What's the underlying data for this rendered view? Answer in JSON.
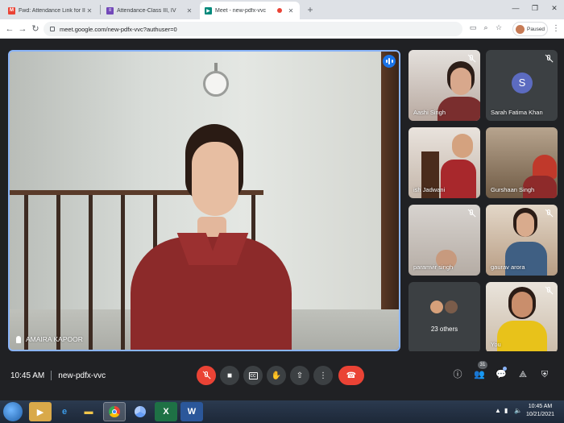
{
  "browser": {
    "tabs": [
      {
        "title": "Fwd: Attendance Link for III - IV",
        "favicon": "gmail-icon",
        "favicon_color": "#ea4335",
        "active": false
      },
      {
        "title": "Attendance-Class III, IV",
        "favicon": "forms-icon",
        "favicon_color": "#7248b9",
        "active": false
      },
      {
        "title": "Meet - new-pdfx-vvc",
        "favicon": "meet-icon",
        "favicon_color": "#00897b",
        "active": true,
        "recording": true
      }
    ],
    "url": "meet.google.com/new-pdfx-vvc?authuser=0",
    "profile_status": "Paused"
  },
  "meet": {
    "main_speaker": {
      "name": "AMAIRA KAPOOR"
    },
    "participants": [
      {
        "name": "Aashi Singh",
        "muted": true
      },
      {
        "name": "Sarah Fatima Khan",
        "muted": true,
        "initial": "S",
        "avatar_color": "#5c6bc0"
      },
      {
        "name": "ish Jadwani",
        "muted": false
      },
      {
        "name": "Gurshaan Singh",
        "muted": false
      },
      {
        "name": "paramvir singh",
        "muted": true
      },
      {
        "name": "gaurav arora",
        "muted": true
      },
      {
        "name": "23 others",
        "muted": false
      },
      {
        "name": "You",
        "muted": true
      }
    ],
    "time": "10:45 AM",
    "meeting_code": "new-pdfx-vvc",
    "participant_count": "31"
  },
  "taskbar": {
    "apps": [
      "ie-icon",
      "explorer-icon",
      "chrome-icon",
      "chromium-icon",
      "excel-icon",
      "word-icon"
    ],
    "time": "10:45 AM",
    "date": "10/21/2021"
  },
  "colors": {
    "accent_blue": "#8ab4f8",
    "hangup_red": "#ea4335",
    "meet_bg": "#202124"
  }
}
